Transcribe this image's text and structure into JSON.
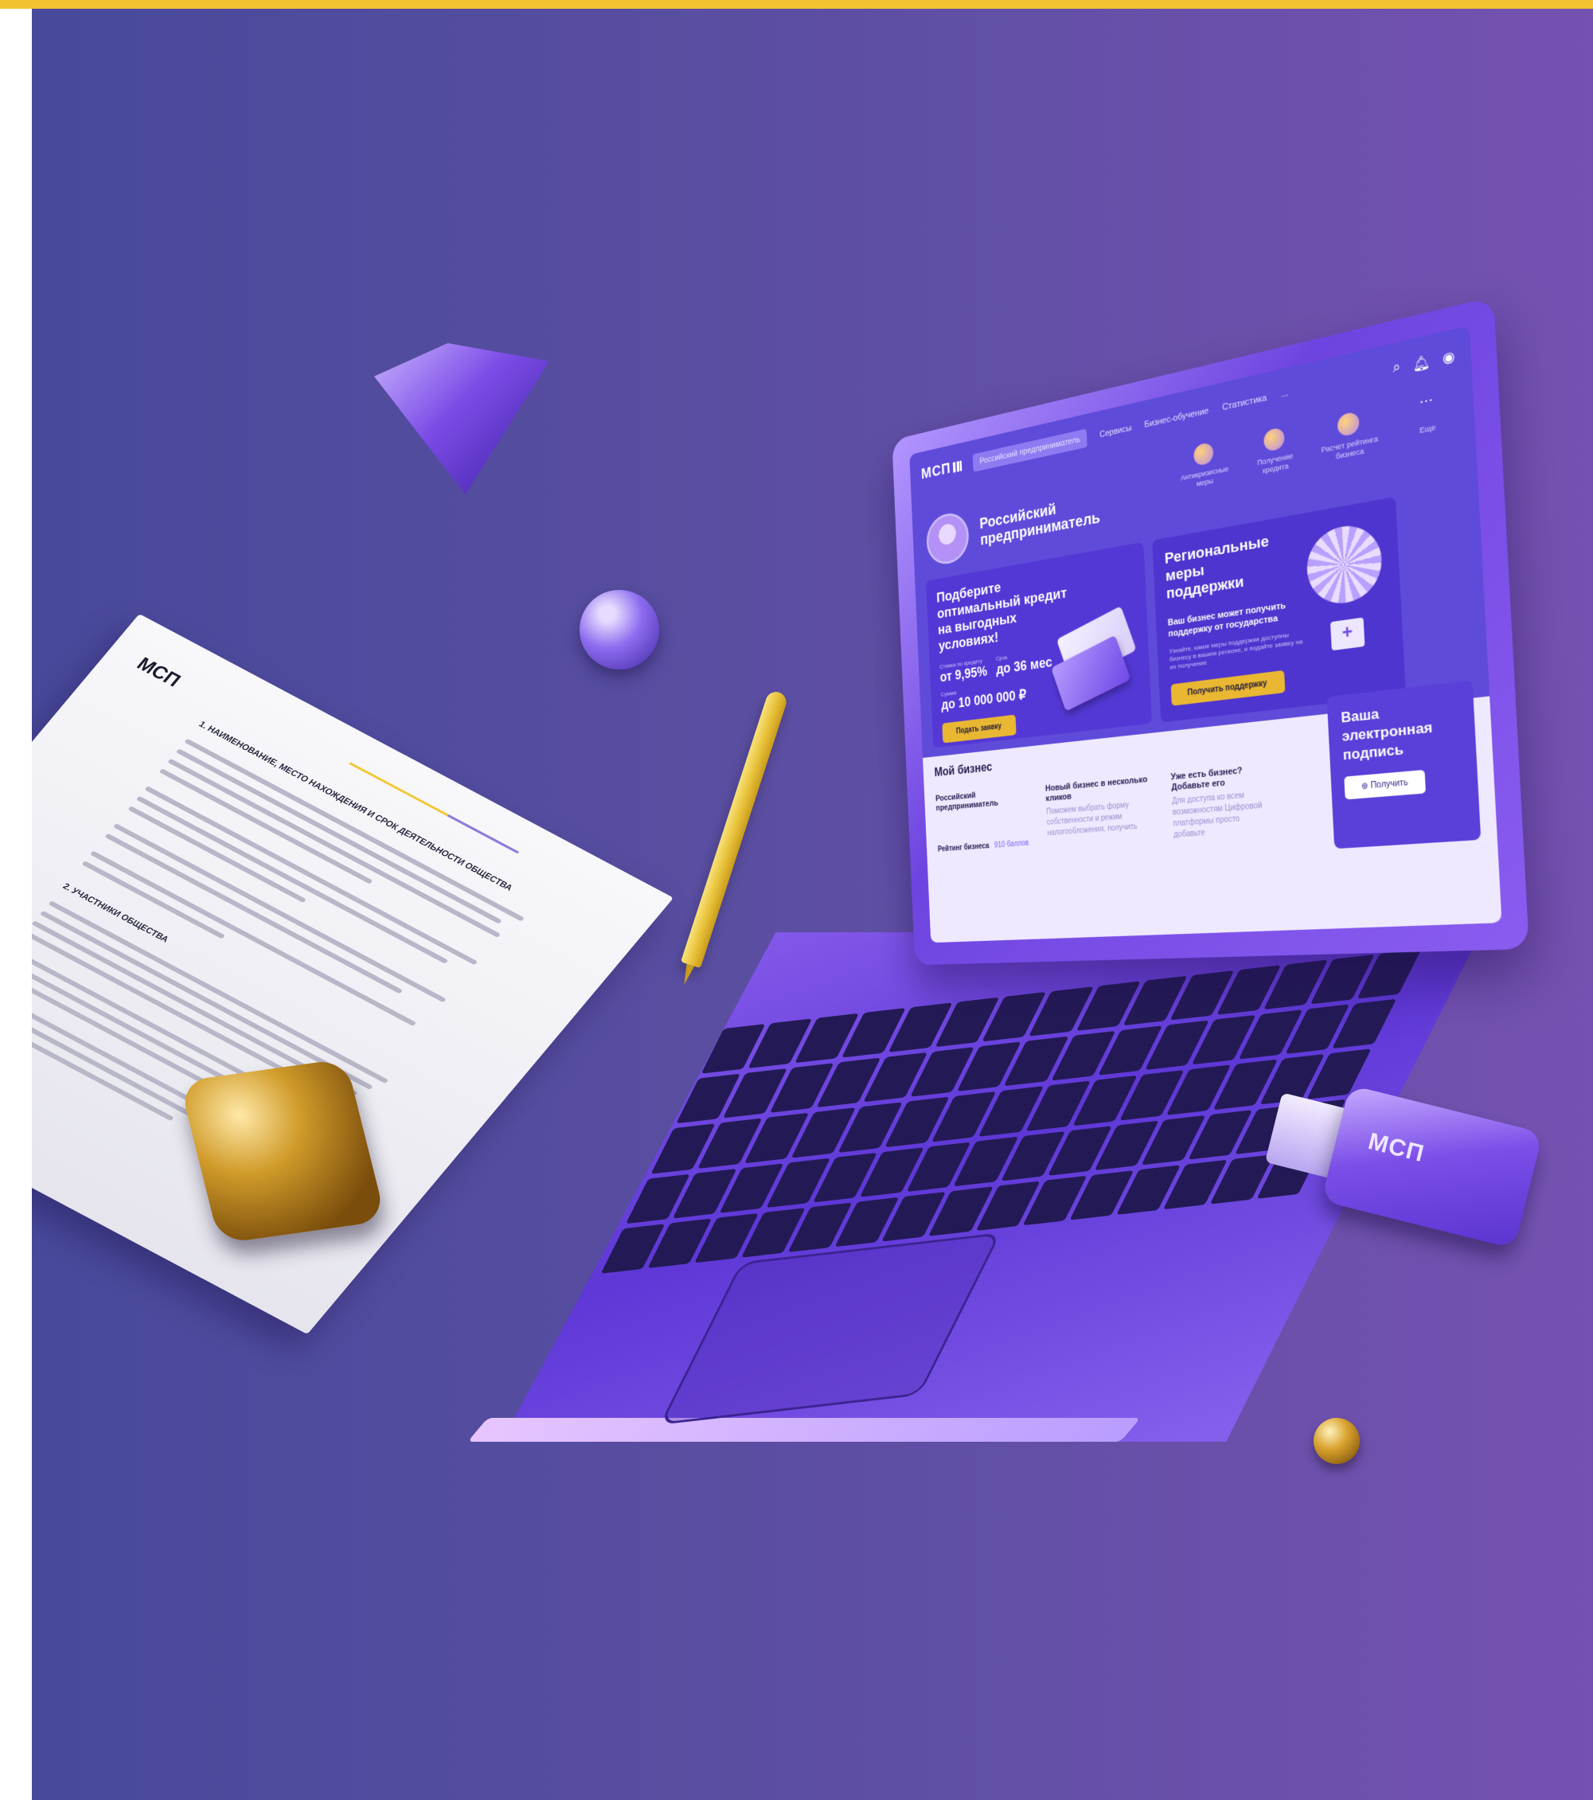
{
  "brand": {
    "logo": "МСП",
    "colors": {
      "accent_yellow": "#f2c231",
      "purple": "#5f4bd9",
      "gold": "#d09b2a"
    }
  },
  "site": {
    "nav": {
      "active": "Российский предприниматель",
      "items": [
        "Сервисы",
        "Бизнес-обучение",
        "Статистика",
        "..."
      ]
    },
    "quick_actions": [
      {
        "icon": "pin-icon",
        "label": "Антикризисные меры"
      },
      {
        "icon": "card-icon",
        "label": "Получение кредита"
      },
      {
        "icon": "star-icon",
        "label": "Расчет рейтинга бизнеса"
      },
      {
        "icon": "more-icon",
        "label": "Еще"
      }
    ],
    "profile_name": "Российский предприниматель",
    "credit_card": {
      "title": "Подберите оптимальный кредит на выгодных условиях!",
      "rate_label": "Ставка по кредиту",
      "rate_value": "от 9,95%",
      "term_label": "Срок",
      "term_value": "до 36 мес",
      "sum_label": "Сумма",
      "sum_value": "до 10 000 000 ₽",
      "button": "Подать заявку"
    },
    "regional_card": {
      "title": "Региональные меры поддержки",
      "subtitle": "Ваш бизнес может получить поддержку от государства",
      "text": "Узнайте, какие меры поддержки доступны бизнесу в вашем регионе, и подайте заявку на их получение",
      "button": "Получить поддержку"
    },
    "my_business": {
      "title": "Мой бизнес",
      "col1_head": "Российский предприниматель",
      "col2_head": "Новый бизнес в несколько кликов",
      "col2_body": "Поможем выбрать форму собственности и режим налогообложения, получить",
      "col3_head": "Уже есть бизнес? Добавьте его",
      "col3_body": "Для доступа ко всем возможностям Цифровой платформы просто добавьте",
      "rating_label": "Рейтинг бизнеса",
      "rating_points": "910 баллов"
    },
    "signature_card": {
      "title": "Ваша электронная подпись",
      "button": "Получить"
    }
  },
  "document": {
    "logo": "МСП",
    "section1": "1. НАИМЕНОВАНИЕ, МЕСТО НАХОЖДЕНИЯ И СРОК ДЕЯТЕЛЬНОСТИ ОБЩЕСТВА",
    "section2": "2. УЧАСТНИКИ ОБЩЕСТВА"
  },
  "usb": {
    "label": "МСП"
  }
}
